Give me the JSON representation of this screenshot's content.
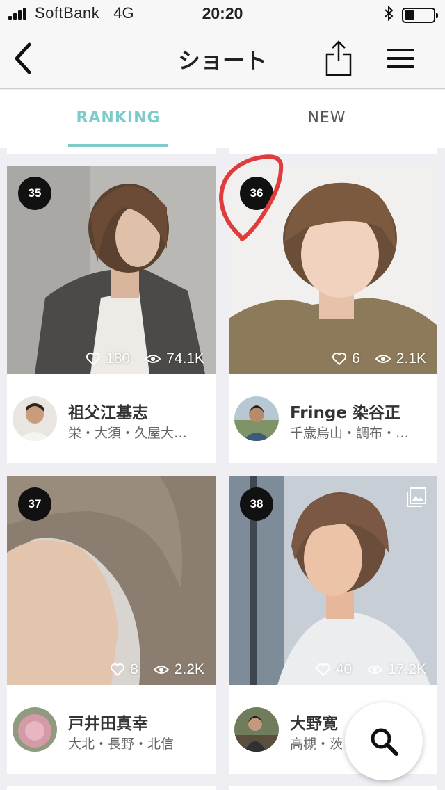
{
  "status_bar": {
    "carrier": "SoftBank",
    "network": "4G",
    "time": "20:20",
    "battery_level": 0.35
  },
  "nav": {
    "title": "ショート",
    "back_icon": "chevron-left-icon",
    "share_icon": "share-icon",
    "menu_icon": "hamburger-menu-icon"
  },
  "tabs": [
    {
      "label": "RANKING",
      "active": true
    },
    {
      "label": "NEW",
      "active": false
    }
  ],
  "colors": {
    "accent": "#7ecbc9",
    "background": "#efeef3",
    "rank_badge": "#111111",
    "annotation": "#e03c3c"
  },
  "cards": [
    {
      "rank": "35",
      "likes": "180",
      "views": "74.1K",
      "author": "祖父江基志",
      "area": "栄・大須・久屋大…",
      "gallery": false
    },
    {
      "rank": "36",
      "likes": "6",
      "views": "2.1K",
      "author": "Fringe 染谷正",
      "area": "千歳烏山・調布・…",
      "gallery": false
    },
    {
      "rank": "37",
      "likes": "8",
      "views": "2.2K",
      "author": "戸井田真幸",
      "area": "大北・長野・北信",
      "gallery": false
    },
    {
      "rank": "38",
      "likes": "40",
      "views": "17.2K",
      "author": "大野寛",
      "area": "高槻・茨",
      "gallery": true
    }
  ],
  "fab": {
    "icon": "search-icon"
  }
}
